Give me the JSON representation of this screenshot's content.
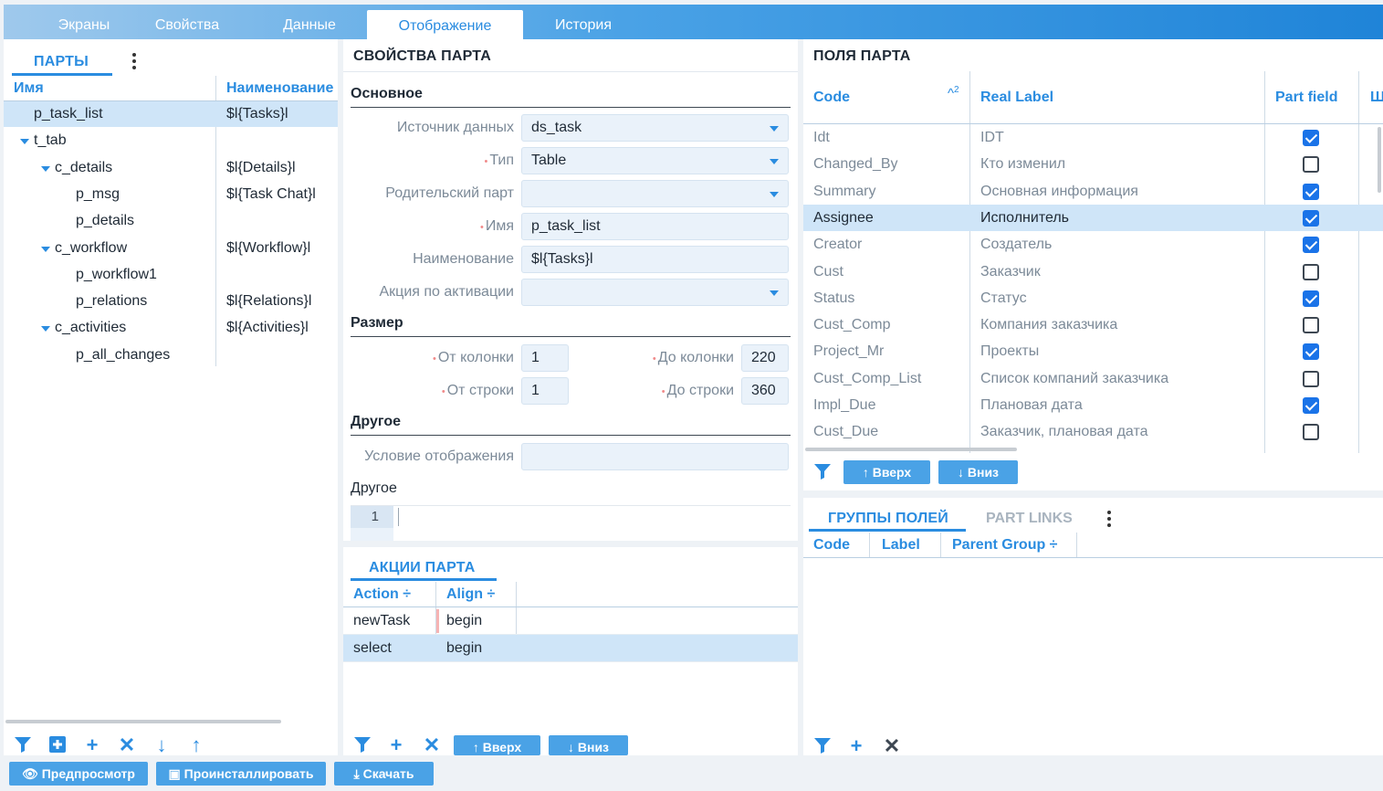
{
  "tabs": [
    "Экраны",
    "Свойства",
    "Данные",
    "Отображение",
    "История"
  ],
  "active_tab": "Отображение",
  "parts": {
    "title": "ПАРТЫ",
    "col_name": "Имя",
    "col_label": "Наименование",
    "rows": [
      {
        "name": "p_task_list",
        "label": "$l{Tasks}l",
        "level": 0,
        "expand": false,
        "selected": true
      },
      {
        "name": "t_tab",
        "label": "",
        "level": 0,
        "expand": true,
        "selected": false
      },
      {
        "name": "c_details",
        "label": "$l{Details}l",
        "level": 1,
        "expand": true,
        "selected": false
      },
      {
        "name": "p_msg",
        "label": "$l{Task Chat}l",
        "level": 2,
        "expand": false,
        "selected": false
      },
      {
        "name": "p_details",
        "label": "",
        "level": 2,
        "expand": false,
        "selected": false
      },
      {
        "name": "c_workflow",
        "label": "$l{Workflow}l",
        "level": 1,
        "expand": true,
        "selected": false
      },
      {
        "name": "p_workflow1",
        "label": "",
        "level": 2,
        "expand": false,
        "selected": false
      },
      {
        "name": "p_relations",
        "label": "$l{Relations}l",
        "level": 2,
        "expand": false,
        "selected": false
      },
      {
        "name": "c_activities",
        "label": "$l{Activities}l",
        "level": 1,
        "expand": true,
        "selected": false
      },
      {
        "name": "p_all_changes",
        "label": "",
        "level": 2,
        "expand": false,
        "selected": false
      }
    ]
  },
  "props": {
    "title": "СВОЙСТВА ПАРТА",
    "group_main": "Основное",
    "data_source_label": "Источник данных",
    "data_source_value": "ds_task",
    "type_label": "Тип",
    "type_value": "Table",
    "parent_label": "Родительский парт",
    "parent_value": "",
    "name_label": "Имя",
    "name_value": "p_task_list",
    "caption_label": "Наименование",
    "caption_value": "$l{Tasks}l",
    "activation_label": "Акция по активации",
    "activation_value": "",
    "group_size": "Размер",
    "from_col_label": "От колонки",
    "from_col_value": "1",
    "to_col_label": "До колонки",
    "to_col_value": "220",
    "from_row_label": "От строки",
    "from_row_value": "1",
    "to_row_label": "До строки",
    "to_row_value": "360",
    "group_other": "Другое",
    "display_cond_label": "Условие отображения",
    "display_cond_value": "",
    "other_label": "Другое",
    "line_no": "1"
  },
  "actions": {
    "title": "АКЦИИ ПАРТА",
    "col_action": "Action ÷",
    "col_align": "Align ÷",
    "rows": [
      {
        "action": "newTask",
        "align": "begin",
        "selected": false
      },
      {
        "action": "select",
        "align": "begin",
        "selected": true
      }
    ],
    "up_label": "Вверх",
    "down_label": "Вниз"
  },
  "fields": {
    "title": "ПОЛЯ ПАРТА",
    "col_code": "Code",
    "sort_index": "2",
    "col_label": "Real Label",
    "col_part": "Part field",
    "col_extra": "Ш",
    "rows": [
      {
        "code": "Idt",
        "label": "IDT",
        "part": true,
        "selected": false
      },
      {
        "code": "Changed_By",
        "label": "Кто изменил",
        "part": false,
        "selected": false
      },
      {
        "code": "Summary",
        "label": "Основная информация",
        "part": true,
        "selected": false
      },
      {
        "code": "Assignee",
        "label": "Исполнитель",
        "part": true,
        "selected": true
      },
      {
        "code": "Creator",
        "label": "Создатель",
        "part": true,
        "selected": false
      },
      {
        "code": "Cust",
        "label": "Заказчик",
        "part": false,
        "selected": false
      },
      {
        "code": "Status",
        "label": "Статус",
        "part": true,
        "selected": false
      },
      {
        "code": "Cust_Comp",
        "label": "Компания заказчика",
        "part": false,
        "selected": false
      },
      {
        "code": "Project_Mr",
        "label": "Проекты",
        "part": true,
        "selected": false
      },
      {
        "code": "Cust_Comp_List",
        "label": "Список компаний заказчика",
        "part": false,
        "selected": false
      },
      {
        "code": "Impl_Due",
        "label": "Плановая дата",
        "part": true,
        "selected": false
      },
      {
        "code": "Cust_Due",
        "label": "Заказчик, плановая дата",
        "part": false,
        "selected": false
      }
    ],
    "up_label": "Вверх",
    "down_label": "Вниз"
  },
  "groups": {
    "tab_groups": "ГРУППЫ ПОЛЕЙ",
    "tab_links": "PART LINKS",
    "col_code": "Code",
    "col_label": "Label",
    "col_parent": "Parent Group ÷"
  },
  "footer": {
    "preview": "Предпросмотр",
    "install": "Проинсталлировать",
    "download": "Скачать"
  },
  "colors": {
    "accent": "#2a8ce0",
    "selected_row": "#cfe5f8",
    "checkbox_on": "#1a73e8"
  }
}
